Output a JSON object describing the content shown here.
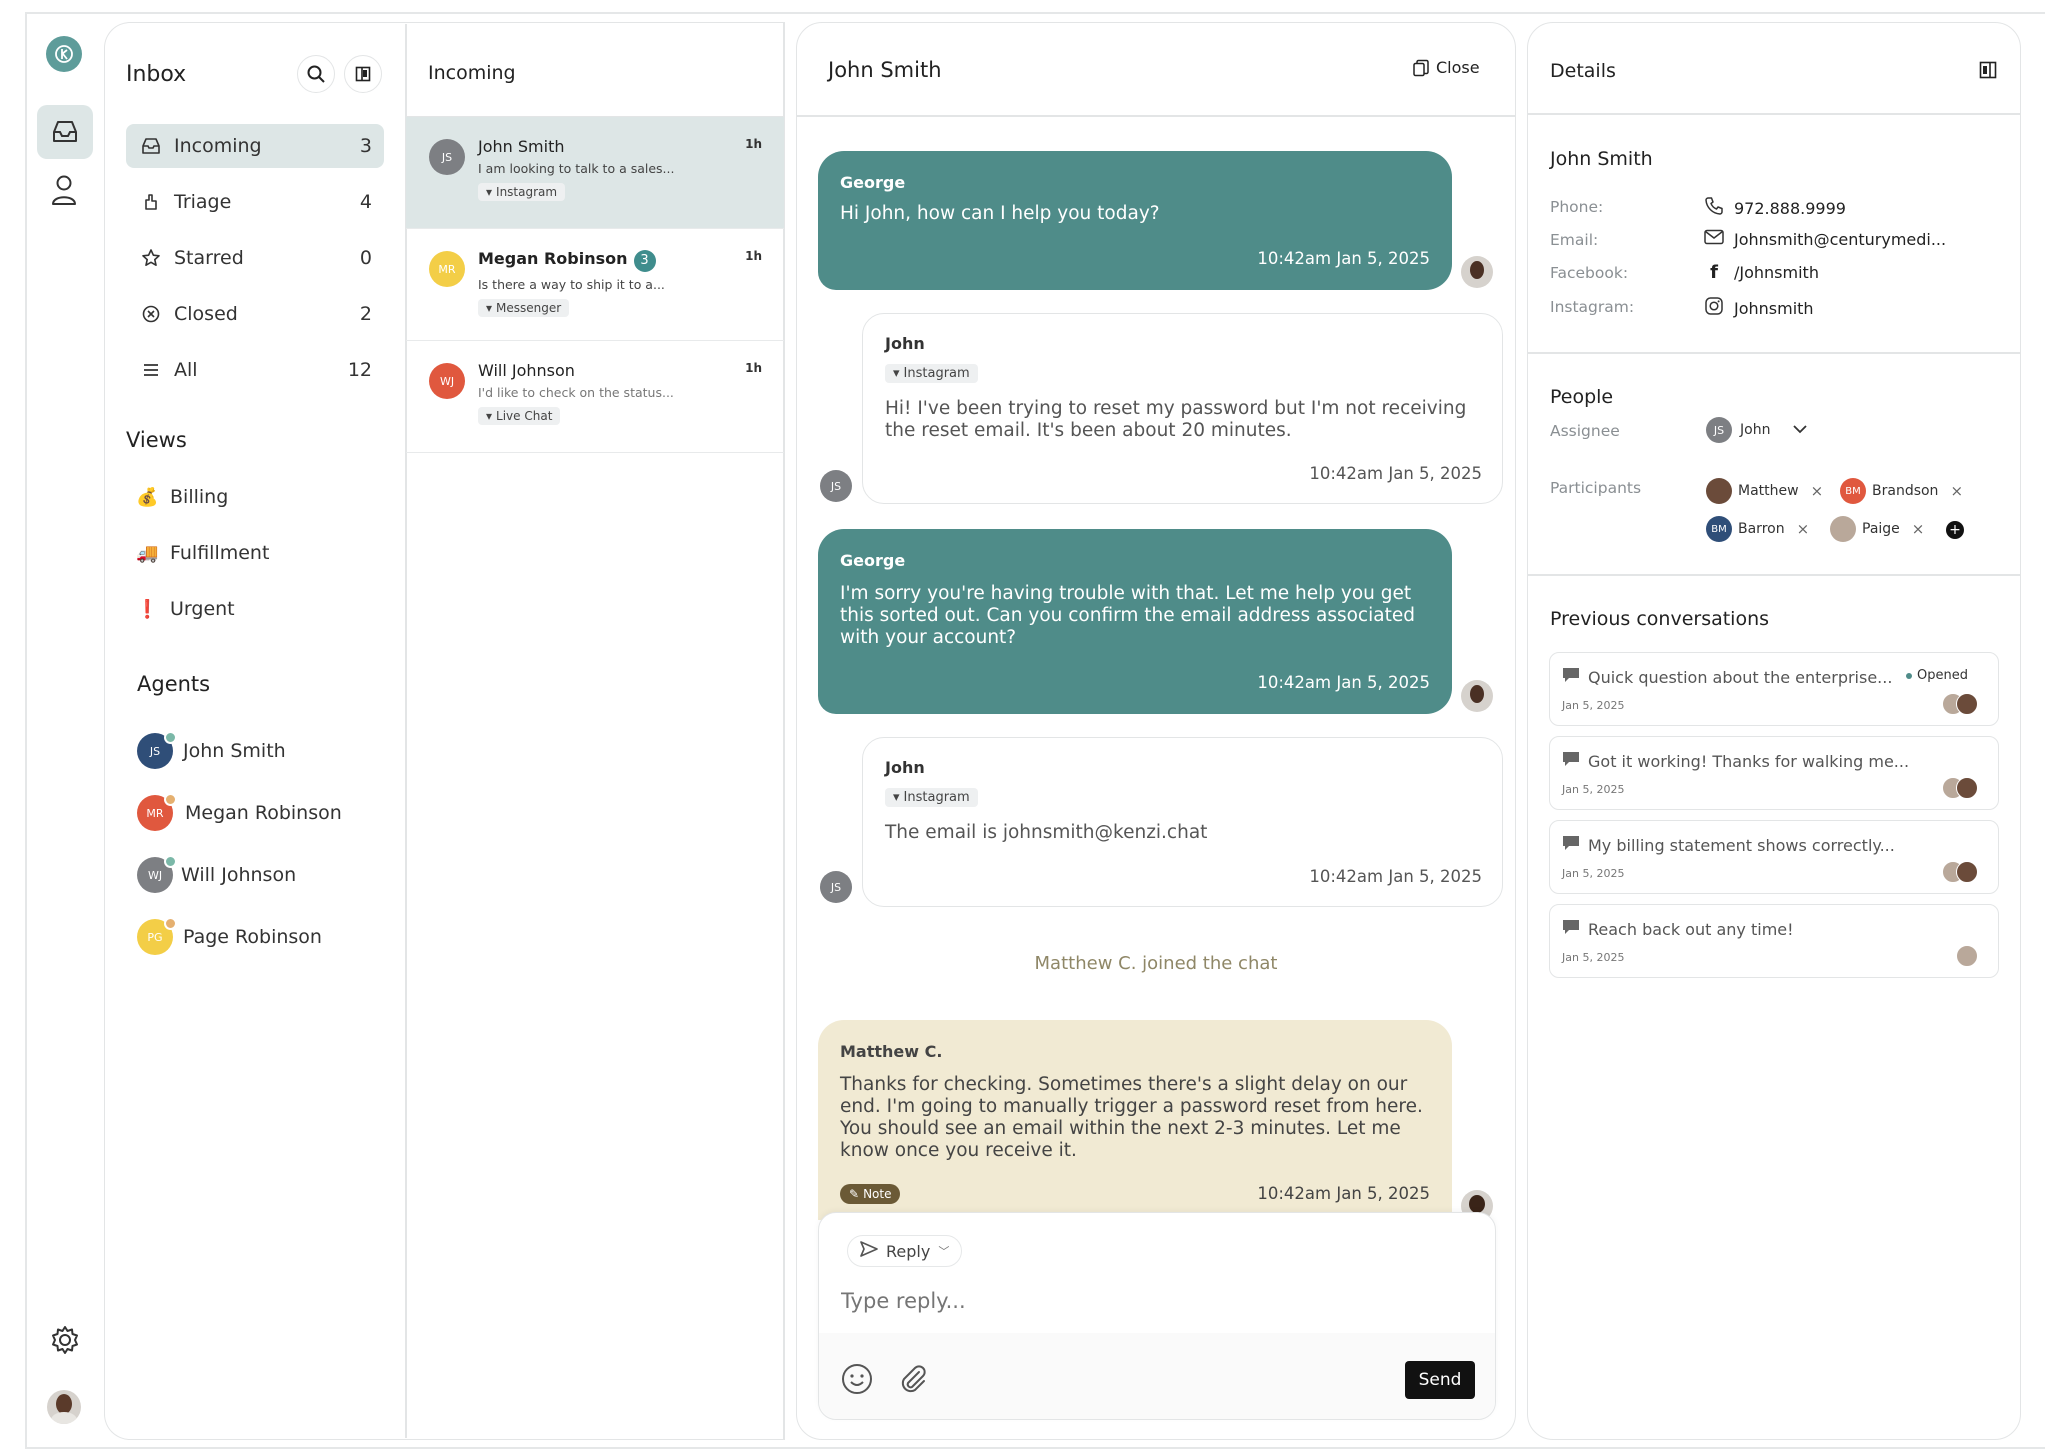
{
  "inbox": {
    "title": "Inbox",
    "nav": [
      {
        "label": "Incoming",
        "count": "3",
        "icon": "tray-icon"
      },
      {
        "label": "Triage",
        "count": "4",
        "icon": "triage-icon"
      },
      {
        "label": "Starred",
        "count": "0",
        "icon": "star-icon"
      },
      {
        "label": "Closed",
        "count": "2",
        "icon": "x-circle-icon"
      },
      {
        "label": "All",
        "count": "12",
        "icon": "stack-icon"
      }
    ],
    "views_title": "Views",
    "views": [
      {
        "label": "Billing",
        "emoji": "💰"
      },
      {
        "label": "Fulfillment",
        "emoji": "🚚"
      },
      {
        "label": "Urgent",
        "emoji": "❗"
      }
    ],
    "agents_title": "Agents",
    "agents": [
      {
        "initials": "JS",
        "name": "John Smith",
        "color": "#2f4e78",
        "status_color": "#7bb8a8"
      },
      {
        "initials": "MR",
        "name": "Megan Robinson",
        "color": "#e0583e",
        "status_color": "#e5b070"
      },
      {
        "initials": "WJ",
        "name": "Will Johnson",
        "color": "#7d7f83",
        "status_color": "#7bb8a8"
      },
      {
        "initials": "PG",
        "name": "Page Robinson",
        "color": "#f3ce47",
        "status_color": "#e5b070"
      }
    ]
  },
  "incoming": {
    "title": "Incoming",
    "conversations": [
      {
        "initials": "JS",
        "name": "John Smith",
        "time": "1h",
        "preview": "I am looking to talk to a sales...",
        "channel": "Instagram",
        "color": "#7d7f83"
      },
      {
        "initials": "MR",
        "name": "Megan Robinson",
        "badge": "3",
        "time": "1h",
        "preview": "Is there a way to ship it to a...",
        "channel": "Messenger",
        "color": "#f3ce47"
      },
      {
        "initials": "WJ",
        "name": "Will Johnson",
        "time": "1h",
        "preview": "I'd like to check on the status...",
        "channel": "Live Chat",
        "color": "#e0583e"
      }
    ]
  },
  "chat": {
    "title": "John Smith",
    "close_label": "Close",
    "messages": [
      {
        "sender": "George",
        "text": "Hi John, how can I help you today?",
        "time": "10:42am Jan 5, 2025"
      },
      {
        "sender": "John",
        "channel": "Instagram",
        "text": "Hi! I've been trying to reset my password but I'm not receiving the reset email. It's been about 20 minutes.",
        "time": "10:42am Jan 5, 2025",
        "initials": "JS"
      },
      {
        "sender": "George",
        "text": "I'm sorry you're having trouble with that. Let me help you get this sorted out. Can you confirm the email address associated with your account?",
        "time": "10:42am Jan 5, 2025"
      },
      {
        "sender": "John",
        "channel": "Instagram",
        "text": "The email is johnsmith@kenzi.chat",
        "time": "10:42am Jan 5, 2025",
        "initials": "JS"
      },
      {
        "sender": "Matthew C.",
        "text": "Thanks for checking. Sometimes there's a slight delay on our end. I'm going to manually trigger a password reset from here. You should see an email within the next 2-3 minutes. Let me know once you receive it.",
        "time": "10:42am Jan 5, 2025",
        "note_label": "Note"
      }
    ],
    "system_message": "Matthew C. joined the chat",
    "composer": {
      "mode_label": "Reply",
      "placeholder": "Type reply...",
      "send_label": "Send"
    }
  },
  "details": {
    "title": "Details",
    "contact_name": "John Smith",
    "fields": [
      {
        "label": "Phone:",
        "value": "972.888.9999",
        "icon": "phone-icon"
      },
      {
        "label": "Email:",
        "value": "Johnsmith@centurymedi...",
        "icon": "mail-icon"
      },
      {
        "label": "Facebook:",
        "value": "/Johnsmith",
        "icon": "facebook-icon"
      },
      {
        "label": "Instagram:",
        "value": "Johnsmith",
        "icon": "instagram-icon"
      }
    ],
    "people_title": "People",
    "assignee_label": "Assignee",
    "assignee": {
      "initials": "JS",
      "name": "John"
    },
    "participants_label": "Participants",
    "participants": [
      {
        "name": "Matthew",
        "initials": "",
        "color": "#6b4b3a"
      },
      {
        "name": "Brandson",
        "initials": "BM",
        "color": "#e0583e"
      },
      {
        "name": "Barron",
        "initials": "BM",
        "color": "#2f4e78"
      },
      {
        "name": "Paige",
        "initials": "",
        "color": "#b9a89a"
      }
    ],
    "prev_title": "Previous conversations",
    "previous": [
      {
        "title": "Quick question about the enterprise...",
        "date": "Jan 5, 2025",
        "status": "Opened"
      },
      {
        "title": "Got it working! Thanks for walking me...",
        "date": "Jan 5, 2025"
      },
      {
        "title": "My billing statement shows correctly...",
        "date": "Jan 5, 2025"
      },
      {
        "title": "Reach back out any time!",
        "date": "Jan 5, 2025"
      }
    ]
  },
  "colors": {
    "accent": "#4f8c89",
    "active_bg": "#dde6e6",
    "note_bg": "#f1ead3",
    "note_tag": "#6b5a36"
  }
}
